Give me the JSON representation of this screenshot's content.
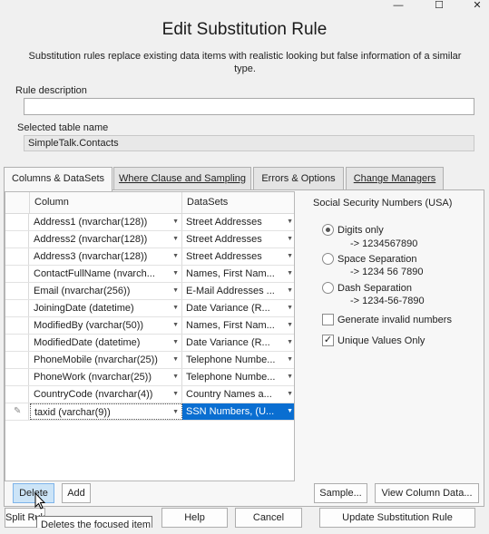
{
  "window": {
    "minimize_glyph": "—",
    "maximize_glyph": "☐",
    "close_glyph": "✕"
  },
  "dialog": {
    "title": "Edit Substitution Rule",
    "subtitle": "Substitution rules replace existing data items with realistic looking but false information of a similar type."
  },
  "rule_description": {
    "label": "Rule description",
    "value": ""
  },
  "selected_table": {
    "label": "Selected table name",
    "value": "SimpleTalk.Contacts"
  },
  "tabs": [
    {
      "label": "Columns & DataSets",
      "active": true
    },
    {
      "label": "Where Clause and Sampling",
      "active": false
    },
    {
      "label": "Errors & Options",
      "active": false
    },
    {
      "label": "Change Managers",
      "active": false
    }
  ],
  "grid": {
    "headers": {
      "column": "Column",
      "datasets": "DataSets"
    },
    "rows": [
      {
        "column": "Address1  (nvarchar(128))",
        "dataset": "Street Addresses"
      },
      {
        "column": "Address2  (nvarchar(128))",
        "dataset": "Street Addresses"
      },
      {
        "column": "Address3  (nvarchar(128))",
        "dataset": "Street Addresses"
      },
      {
        "column": "ContactFullName  (nvarch...",
        "dataset": "Names, First Nam..."
      },
      {
        "column": "Email  (nvarchar(256))",
        "dataset": "E-Mail Addresses ..."
      },
      {
        "column": "JoiningDate  (datetime)",
        "dataset": "Date Variance (R..."
      },
      {
        "column": "ModifiedBy  (varchar(50))",
        "dataset": "Names, First Nam..."
      },
      {
        "column": "ModifiedDate  (datetime)",
        "dataset": "Date Variance (R..."
      },
      {
        "column": "PhoneMobile  (nvarchar(25))",
        "dataset": "Telephone Numbe..."
      },
      {
        "column": "PhoneWork  (nvarchar(25))",
        "dataset": "Telephone Numbe..."
      },
      {
        "column": "CountryCode  (nvarchar(4))",
        "dataset": "Country Names a..."
      },
      {
        "column": "taxid  (varchar(9))",
        "dataset": "SSN Numbers, (U..."
      }
    ],
    "dropdown_glyph": "▼",
    "edit_glyph": "✎"
  },
  "options": {
    "title": "Social Security Numbers (USA)",
    "radios": [
      {
        "label": "Digits only",
        "example": "-> 1234567890",
        "selected": true
      },
      {
        "label": "Space Separation",
        "example": "-> 1234 56 7890",
        "selected": false
      },
      {
        "label": "Dash Separation",
        "example": "-> 1234-56-7890",
        "selected": false
      }
    ],
    "checks": [
      {
        "label": "Generate invalid numbers",
        "checked": false
      },
      {
        "label": "Unique Values Only",
        "checked": true
      }
    ],
    "check_glyph": "✓"
  },
  "buttons": {
    "delete": "Delete",
    "add": "Add",
    "sample": "Sample...",
    "view_column_data": "View Column Data...",
    "split_rule": "Split Rule",
    "help": "Help",
    "cancel": "Cancel",
    "update": "Update Substitution Rule"
  },
  "tooltip": "Deletes the focused item"
}
